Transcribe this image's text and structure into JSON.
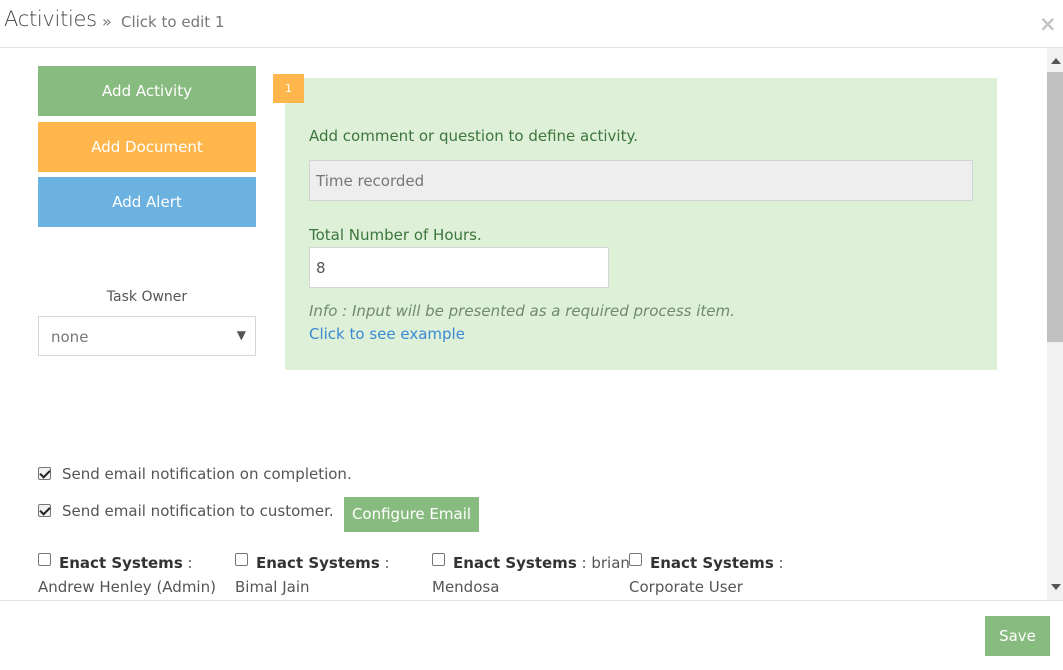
{
  "header": {
    "title": "Activities",
    "breadcrumb_separator": "»",
    "breadcrumb": "Click to edit 1",
    "close_glyph": "×"
  },
  "sidebar": {
    "add_activity": "Add Activity",
    "add_document": "Add Document",
    "add_alert": "Add Alert",
    "task_owner_label": "Task Owner",
    "task_owner_value": "none",
    "caret": "▼"
  },
  "activity": {
    "step_number": "1",
    "prompt": "Add comment or question to define activity.",
    "question_value": "Time recorded",
    "hours_label": "Total Number of Hours.",
    "hours_value": "8",
    "info": "Info : Input will be presented as a required process item.",
    "example_link": "Click to see example"
  },
  "notifications": {
    "on_completion": {
      "label": "Send email notification on completion.",
      "checked": true
    },
    "to_customer": {
      "label": "Send email notification to customer.",
      "checked": true
    },
    "configure_email": "Configure Email"
  },
  "users": [
    {
      "company": "Enact Systems",
      "sep": " : ",
      "name_line1": "",
      "name_line2": "Andrew Henley (Admin)",
      "checked": false
    },
    {
      "company": "Enact Systems",
      "sep": " : ",
      "name_line1": "",
      "name_line2": "Bimal Jain",
      "checked": false
    },
    {
      "company": "Enact Systems",
      "sep": " : ",
      "name_line1": "brian",
      "name_line2": "Mendosa",
      "checked": false
    },
    {
      "company": "Enact Systems",
      "sep": " : ",
      "name_line1": "",
      "name_line2": "Corporate User",
      "checked": false
    }
  ],
  "footer": {
    "save": "Save"
  },
  "colors": {
    "green_button": "#88bb7f",
    "orange_button": "#ffb74d",
    "blue_button": "#6cb2e0",
    "panel_bg": "#dff0d8",
    "link": "#3a8ad3"
  },
  "icons": {
    "close": "close-icon",
    "dropdown": "chevron-down-icon",
    "checkbox_checked": "checkbox-checked-icon",
    "checkbox_unchecked": "checkbox-unchecked-icon"
  }
}
